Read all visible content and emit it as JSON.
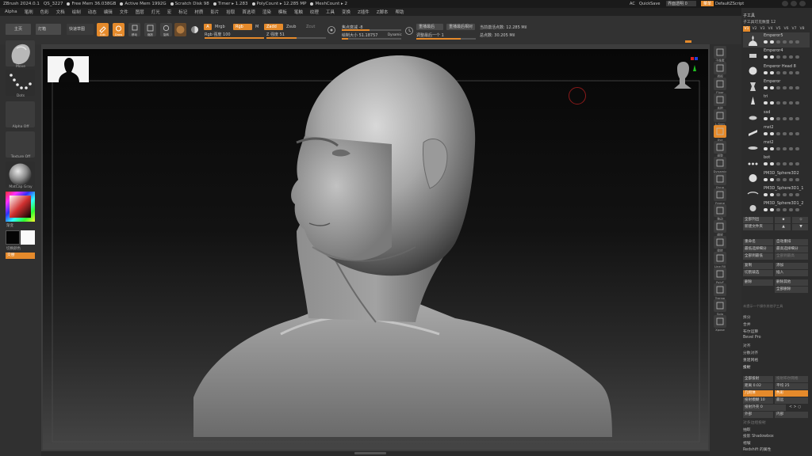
{
  "titlebar": {
    "app": "ZBrush 2024.0.1",
    "doc": "QS_3227",
    "stats": [
      "Free Mem 36.038GB",
      "Active Mem 1992G",
      "Scratch Disk 98",
      "Timer ▸ 1.283",
      "PolyCount ▸ 12.285 MP",
      "MeshCount ▸ 2"
    ],
    "right": [
      "AC",
      "QuickSave",
      "界面透明 0",
      "菜单",
      "DefaultZScript"
    ]
  },
  "menubar": {
    "items": [
      "Alpha",
      "笔刷",
      "色彩",
      "文档",
      "绘制",
      "动态",
      "编辑",
      "文件",
      "图层",
      "灯光",
      "宏",
      "标记",
      "材质",
      "影片",
      "拾取",
      "首选项",
      "渲染",
      "模板",
      "笔触",
      "纹理",
      "工具",
      "变换",
      "Z插件",
      "Z脚本",
      "帮助"
    ]
  },
  "toolbar": {
    "home": "主页",
    "lightbox": "灯箱",
    "quicksketch": "快速草图",
    "buttons": [
      "Edit",
      "Draw",
      "移动",
      "缩放",
      "旋转"
    ],
    "mrgb": "Mrgb",
    "rgb": "Rgb",
    "m": "M",
    "zadd": "Zadd",
    "zsub": "Zsub",
    "zcut": "Zcut",
    "rgb_intensity_label": "Rgb 强度",
    "rgb_intensity": "100",
    "z_intensity_label": "Z 强度",
    "z_intensity": "51",
    "focal_label": "焦点衰减",
    "focal": "-8",
    "draw_size_label": "绘制大小",
    "draw_size": "51.18757",
    "dynamic": "Dynamic",
    "replay_last": "重播最后",
    "replay_last_rel": "重播最后相对",
    "adjust_last_label": "调整最后一个",
    "adjust_last": "1",
    "active_points_label": "当前激活点数:",
    "active_points": "12.285 Mil",
    "total_points_label": "总点数:",
    "total_points": "30.205 Mil",
    "a_btn": "A"
  },
  "lefttray": {
    "brush": "Move",
    "stroke": "Dots",
    "alpha": "Alpha Off",
    "texture": "Texture Off",
    "material": "MatCap Gray",
    "gradient": "渐变",
    "switch_color": "切换颜色",
    "alternate": "交替"
  },
  "rshelf": {
    "items": [
      "子像素",
      "透视",
      "Floor",
      "本地",
      "L.Sym",
      "Xyz",
      "调整",
      "Dynamic",
      "Dyna",
      "Frame",
      "移动",
      "缩放",
      "旋转",
      "Line Fill",
      "PolyF",
      "Transp",
      "Solo",
      "Xpose"
    ]
  },
  "rpanel": {
    "title": "子工具",
    "count_label": "子工具可见数量 12",
    "tabs": [
      "V1",
      "V2",
      "V3",
      "V4",
      "V5",
      "V6",
      "V7",
      "V8"
    ],
    "subtools": [
      "Emperor5",
      "Emperor4",
      "Emperor Head 8",
      "Emperor",
      "tri",
      "ssd",
      "mst2",
      "mst2",
      "bot",
      "PM3D_Sphere3D2",
      "PM3D_Sphere3D1_1",
      "PM3D_Sphere3D1_2"
    ],
    "listall": "全部列出",
    "newfolder": "新建文件夹",
    "ops": [
      "重命名",
      "自动重排",
      "最低选择细分",
      "最高选择细分",
      "全部到最低",
      "全部到最高",
      "复制",
      "添加",
      "切割裁选",
      "插入",
      "删除",
      "删除其他",
      "",
      "全部删除"
    ],
    "note": "未提示一个操作其他子工具",
    "sections": [
      "拆分",
      "合并",
      "布尔运算",
      "Bevel Pro",
      "对齐",
      "分散对齐",
      "重建网格",
      "投射"
    ],
    "project_all": "全部投射",
    "project_boolean": "投射布尔网格",
    "dist_label": "距离",
    "dist": "0.02",
    "mean_label": "平均",
    "mean": "25",
    "geometry": "几何体",
    "color": "色彩",
    "sharp_label": "投射模糊",
    "sharp": "10",
    "farthest": "最远",
    "outer_label": "投射外壳",
    "outer": "0",
    "outer_sym": "< > ○",
    "outer_btn": "外部",
    "inner_btn": "内部",
    "more": [
      "对多边组投射",
      "抽取",
      "投影 Shadowbox",
      "褶皱"
    ],
    "redshift": "Redshift 的属性"
  }
}
